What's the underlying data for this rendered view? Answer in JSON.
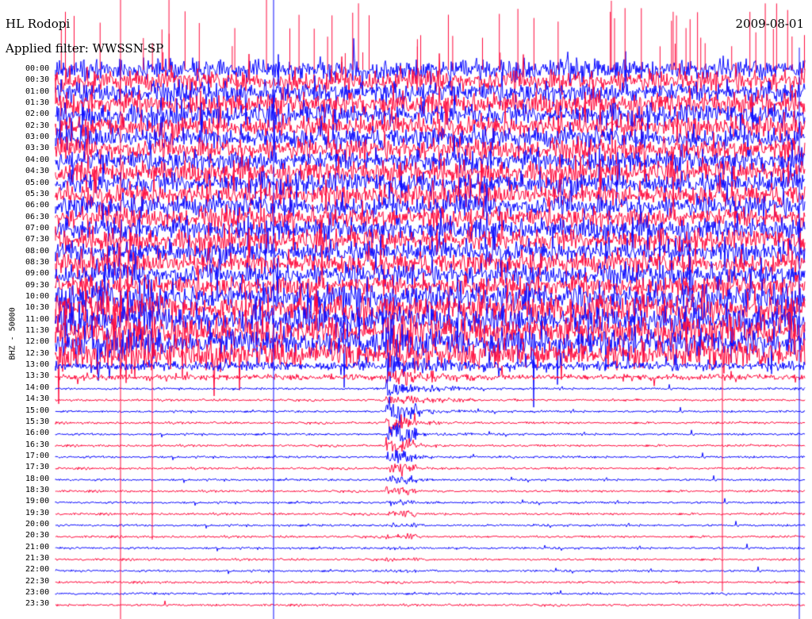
{
  "header": {
    "station": "HL Rodopi",
    "date": "2009-08-01",
    "filter_label": "Applied filter: WWSSN-SP",
    "channel": "BHZ - 50000"
  },
  "colors": {
    "trace_a": "#ff0a3c",
    "trace_b": "#0a0aff",
    "background": "#ffffff",
    "text": "#000000"
  },
  "chart_data": {
    "type": "line",
    "title": "HL Rodopi",
    "subtitle": "Applied filter: WWSSN-SP",
    "date_label": "2009-08-01",
    "ylabel": "BHZ - 50000",
    "y_tick_labels": [
      "00:00",
      "00:30",
      "01:00",
      "01:30",
      "02:00",
      "02:30",
      "03:00",
      "03:30",
      "04:00",
      "04:30",
      "05:00",
      "05:30",
      "06:00",
      "06:30",
      "07:00",
      "07:30",
      "08:00",
      "08:30",
      "09:00",
      "09:30",
      "10:00",
      "10:30",
      "11:00",
      "11:30",
      "12:00",
      "12:30",
      "13:00",
      "13:30",
      "14:00",
      "14:30",
      "15:00",
      "15:30",
      "16:00",
      "16:30",
      "17:00",
      "17:30",
      "18:00",
      "18:30",
      "19:00",
      "19:30",
      "20:00",
      "20:30",
      "21:00",
      "21:30",
      "22:00",
      "22:30",
      "23:00",
      "23:30"
    ],
    "trace_colors_alternating": [
      "#0a0aff",
      "#ff0a3c"
    ],
    "grid": false,
    "legend": "none"
  }
}
